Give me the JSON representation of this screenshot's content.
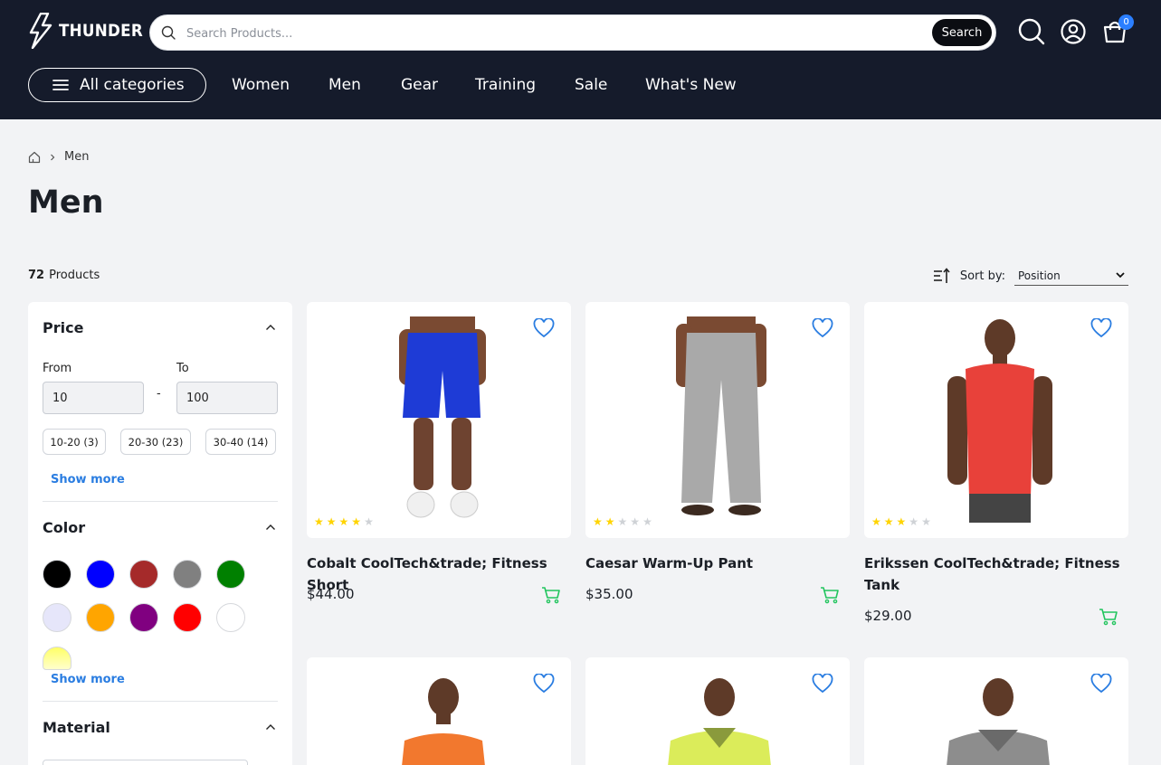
{
  "brand": {
    "name": "THUNDER"
  },
  "search": {
    "placeholder": "Search Products...",
    "button": "Search"
  },
  "header_icons": {
    "cart_count": "0"
  },
  "nav": {
    "all_categories": "All categories",
    "items": [
      "Women",
      "Men",
      "Gear",
      "Training",
      "Sale",
      "What's New"
    ]
  },
  "breadcrumb": {
    "current": "Men"
  },
  "page": {
    "title": "Men"
  },
  "listing": {
    "count": "72",
    "count_label": "Products",
    "sort_label": "Sort by:",
    "sort_value": "Position"
  },
  "filters": {
    "price": {
      "title": "Price",
      "from_label": "From",
      "to_label": "To",
      "from_value": "10",
      "to_value": "100",
      "separator": "-",
      "ranges": [
        "10-20 (3)",
        "20-30 (23)",
        "30-40 (14)"
      ],
      "show_more": "Show more"
    },
    "color": {
      "title": "Color",
      "swatches": [
        "#000000",
        "#0000ff",
        "#a52a2a",
        "#808080",
        "#008000",
        "#e6e6fa",
        "#ffa500",
        "#800080",
        "#ff0000",
        "#ffffff",
        "#ffff66"
      ],
      "show_more": "Show more"
    },
    "material": {
      "title": "Material"
    }
  },
  "products": [
    {
      "name": "Cobalt CoolTech&trade; Fitness Short",
      "price": "$44.00",
      "rating": 4
    },
    {
      "name": "Caesar Warm-Up Pant",
      "price": "$35.00",
      "rating": 2
    },
    {
      "name": "Erikssen CoolTech&trade; Fitness Tank",
      "price": "$29.00",
      "rating": 3
    },
    {
      "name": "",
      "price": "",
      "rating": 0
    },
    {
      "name": "",
      "price": "",
      "rating": 0
    },
    {
      "name": "",
      "price": "",
      "rating": 0
    }
  ],
  "colors": {
    "header_bg": "#151b2b",
    "accent": "#2a7de1",
    "cart_green": "#22c55e",
    "star": "#ffd400"
  }
}
